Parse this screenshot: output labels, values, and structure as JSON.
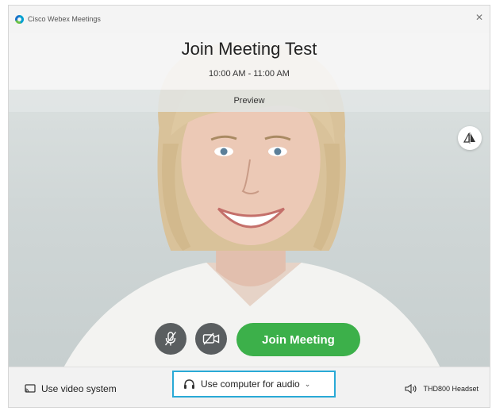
{
  "app": {
    "name": "Cisco Webex Meetings"
  },
  "meeting": {
    "title": "Join Meeting Test",
    "time": "10:00 AM - 11:00 AM",
    "preview_label": "Preview"
  },
  "controls": {
    "join_label": "Join Meeting"
  },
  "bottom": {
    "video_system_label": "Use video system",
    "audio_label": "Use computer for audio",
    "speaker_label": "THD800 Headset"
  },
  "colors": {
    "join_green": "#3cb04a",
    "focus_blue": "#29a9d6",
    "control_gray": "#5a5e60"
  },
  "icons": [
    "webex-logo-icon",
    "close-icon",
    "mirror-icon",
    "mute-mic-icon",
    "video-off-icon",
    "video-system-icon",
    "headset-icon",
    "chevron-down-icon",
    "speaker-icon"
  ]
}
